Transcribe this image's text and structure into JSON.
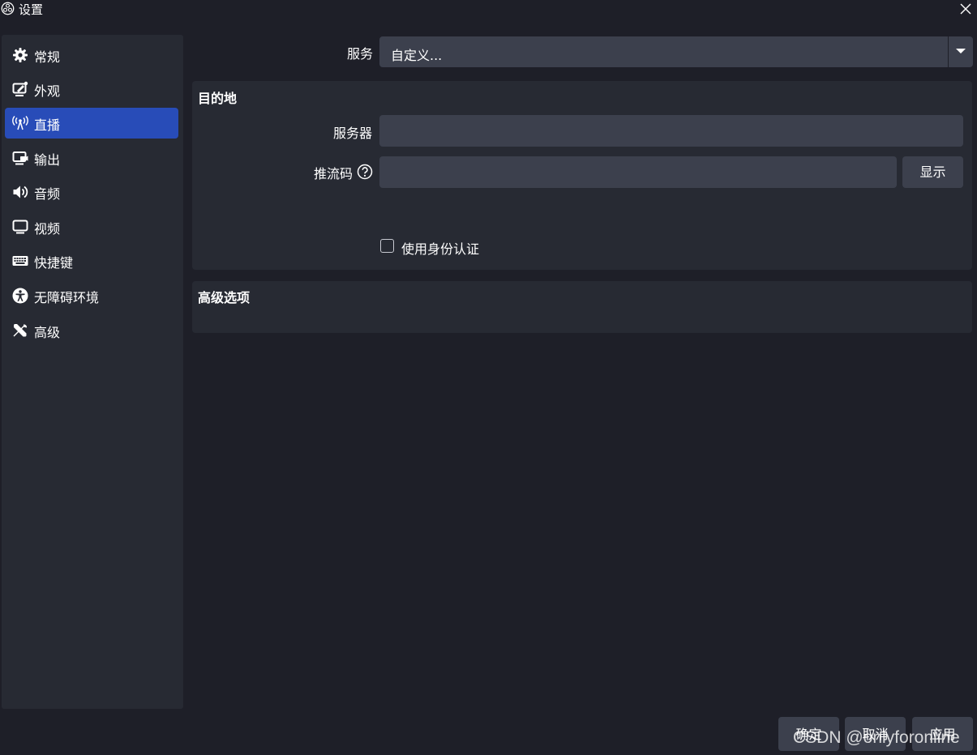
{
  "window": {
    "title": "设置"
  },
  "sidebar": {
    "items": [
      {
        "label": "常规",
        "icon": "gear-icon"
      },
      {
        "label": "外观",
        "icon": "appearance-icon"
      },
      {
        "label": "直播",
        "icon": "antenna-icon",
        "active": true
      },
      {
        "label": "输出",
        "icon": "output-icon"
      },
      {
        "label": "音频",
        "icon": "speaker-icon"
      },
      {
        "label": "视频",
        "icon": "monitor-icon"
      },
      {
        "label": "快捷键",
        "icon": "keyboard-icon"
      },
      {
        "label": "无障碍环境",
        "icon": "accessibility-icon"
      },
      {
        "label": "高级",
        "icon": "tools-icon"
      }
    ]
  },
  "service": {
    "label": "服务",
    "value": "自定义..."
  },
  "destination": {
    "title": "目的地",
    "server_label": "服务器",
    "server_value": "",
    "stream_key_label": "推流码",
    "stream_key_value": "",
    "show_button": "显示",
    "use_auth_label": "使用身份认证",
    "use_auth_checked": false
  },
  "advanced": {
    "title": "高级选项"
  },
  "footer": {
    "ok": "确定",
    "cancel": "取消",
    "apply": "应用"
  },
  "watermark": "CSDN @onlyforonline",
  "colors": {
    "background": "#1e1f28",
    "panel": "#272a33",
    "input": "#3c404d",
    "accent": "#284cb8"
  }
}
